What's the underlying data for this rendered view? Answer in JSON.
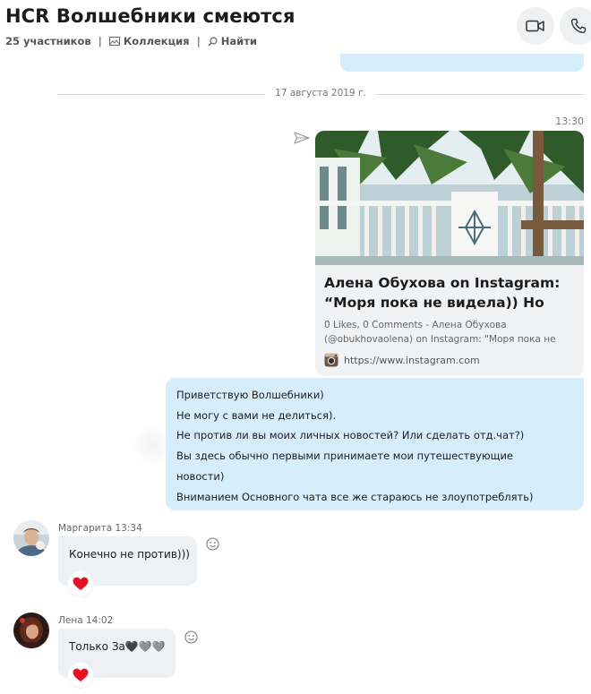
{
  "header": {
    "title": "HCR Волшебники смеются",
    "participants": "25 участников",
    "separator": "|",
    "collection": "Коллекция",
    "find": "Найти"
  },
  "date_separator": "17 августа 2019 г.",
  "outgoing": {
    "time": "13:30",
    "link_preview": {
      "title_line1": "Алена Обухова on Instagram:",
      "title_line2": "“Моря пока не видела)) Но",
      "desc_line1": "0 Likes, 0 Comments - Алена Обухова",
      "desc_line2": "(@obukhovaolena) on Instagram: \"Моря пока не",
      "url": "https://www.instagram.com"
    },
    "message_lines": [
      "Приветствую Волшебники)",
      "Не могу с вами не делиться).",
      "Не против ли вы моих личных новостей? Или сделать отд.чат?)",
      "Вы здесь обычно первыми принимаете мои путешествующие новости)",
      "Вниманием Основного чата все же стараюсь не злоупотреблять)"
    ]
  },
  "incoming": [
    {
      "sender": "Маргарита 13:34",
      "text": "Конечно не против)))",
      "reaction": "heart"
    },
    {
      "sender": "Лена 14:02",
      "text": "Только За🖤🩶🩶",
      "reaction": "heart"
    }
  ],
  "colors": {
    "outgoing_bubble": "#d6eefc",
    "incoming_bubble": "#eef1f4",
    "reaction_heart": "#e81123"
  }
}
